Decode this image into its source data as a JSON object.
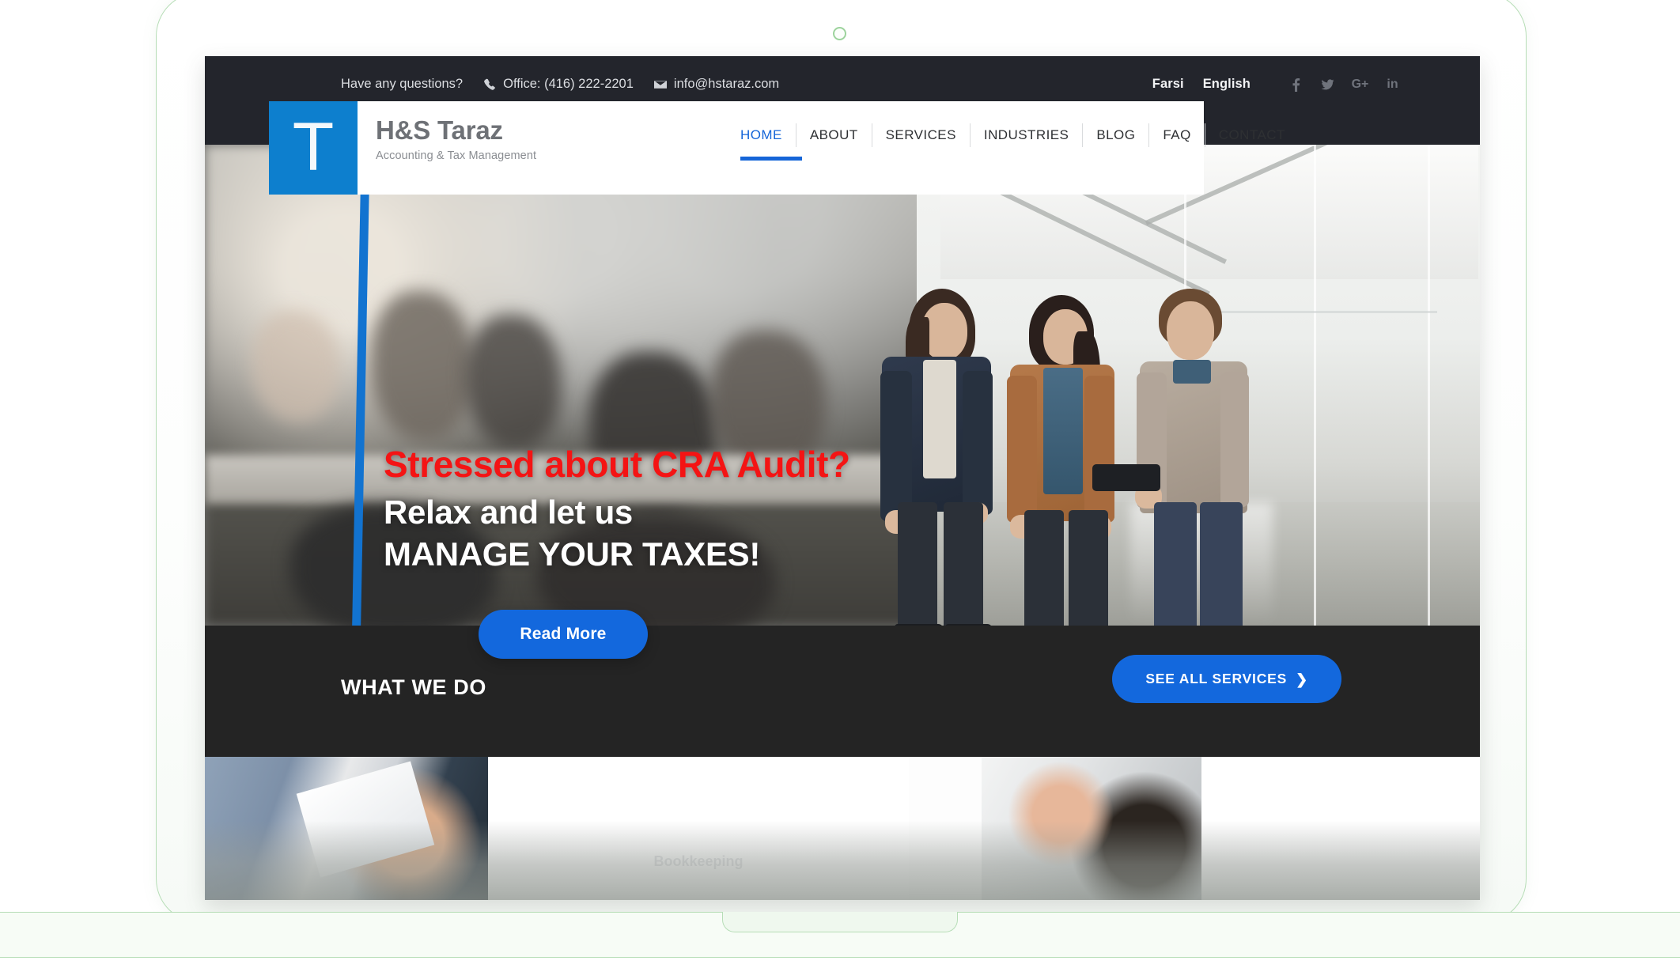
{
  "device": {
    "type": "laptop-mockup",
    "frame_color": "#b6ddb6",
    "camera_icon": "camera-dot-icon"
  },
  "topbar": {
    "question_text": "Have any questions?",
    "phone_icon": "phone-icon",
    "phone_text": "Office: (416) 222-2201",
    "mail_icon": "envelope-icon",
    "email_text": "info@hstaraz.com",
    "languages": [
      {
        "label": "Farsi"
      },
      {
        "label": "English"
      }
    ],
    "social": [
      {
        "name": "facebook-icon",
        "glyph": "f"
      },
      {
        "name": "twitter-icon",
        "glyph": "t"
      },
      {
        "name": "google-plus-icon",
        "glyph": "G+"
      },
      {
        "name": "linkedin-icon",
        "glyph": "in"
      }
    ],
    "background_color": "#23252c"
  },
  "header": {
    "logo_mark_letter": "T",
    "logo_mark_color": "#0d7fce",
    "brand_name": "H&S Taraz",
    "brand_tagline": "Accounting & Tax Management",
    "nav": [
      {
        "label": "HOME",
        "active": true
      },
      {
        "label": "ABOUT",
        "active": false
      },
      {
        "label": "SERVICES",
        "active": false
      },
      {
        "label": "INDUSTRIES",
        "active": false
      },
      {
        "label": "BLOG",
        "active": false
      },
      {
        "label": "FAQ",
        "active": false
      },
      {
        "label": "CONTACT",
        "active": false
      }
    ],
    "active_color": "#1565d8"
  },
  "hero": {
    "headline_red": "Stressed about CRA Audit?",
    "headline_white_1": "Relax and let us",
    "headline_white_2": "MANAGE YOUR TAXES!",
    "red_color": "#f41414",
    "cta_label": "Read More",
    "cta_color": "#1368dd",
    "accent_line_color": "#1273d0",
    "image_description": "Three business colleagues talking in a bright modern office corridor"
  },
  "what_we_do": {
    "title": "WHAT WE DO",
    "button_label": "SEE ALL SERVICES",
    "button_chevron": "chevron-right-icon",
    "background_color": "#242424",
    "button_color": "#1368dd"
  },
  "services_strip": {
    "cards": [
      {
        "name": "service-card-1",
        "caption": ""
      },
      {
        "name": "service-card-2",
        "caption": "Bookkeeping"
      },
      {
        "name": "service-card-3",
        "caption": ""
      },
      {
        "name": "service-card-4",
        "caption": ""
      },
      {
        "name": "service-card-5",
        "caption": ""
      }
    ]
  }
}
